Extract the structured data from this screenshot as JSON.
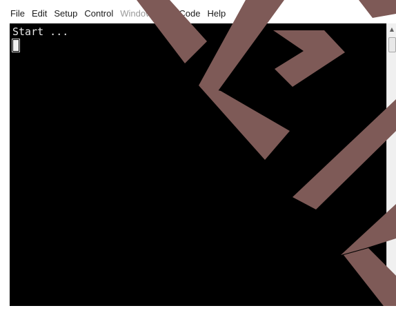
{
  "menu": {
    "items": [
      {
        "label": "File",
        "enabled": true
      },
      {
        "label": "Edit",
        "enabled": true
      },
      {
        "label": "Setup",
        "enabled": true
      },
      {
        "label": "Control",
        "enabled": true
      },
      {
        "label": "Window",
        "enabled": false
      },
      {
        "label": "KanjiCode",
        "enabled": true
      },
      {
        "label": "Help",
        "enabled": true
      }
    ]
  },
  "terminal": {
    "output": "Start ...",
    "background": "#000000",
    "foreground": "#e8e8e8"
  },
  "watermark": {
    "color": "#7e5a57"
  }
}
